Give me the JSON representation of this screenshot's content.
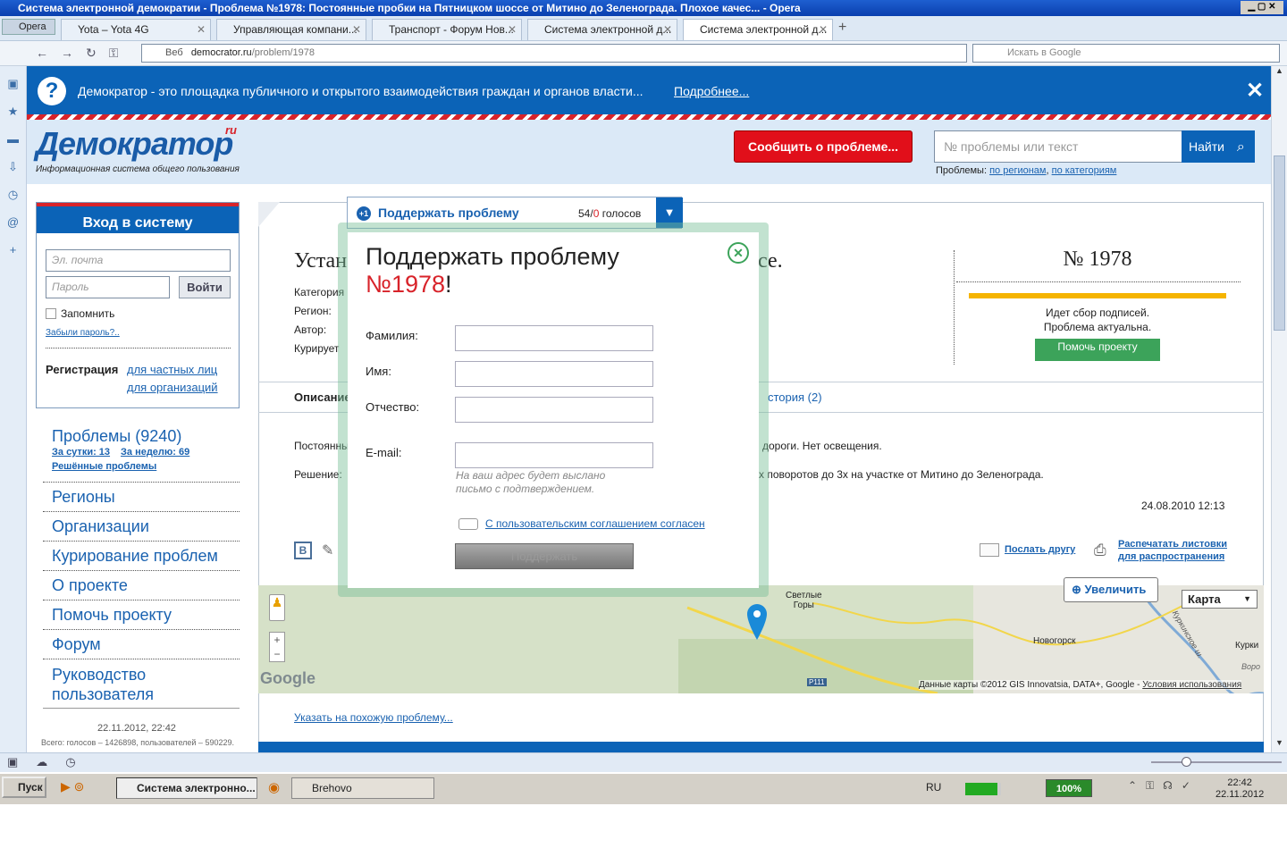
{
  "window": {
    "title": "Система электронной демократии - Проблема №1978: Постоянные пробки на Пятницком шоссе от Митино до Зеленограда. Плохое качес... - Opera",
    "opera_btn": "Opera"
  },
  "tabs": [
    "Yota – Yota 4G",
    "Управляющая компани...",
    "Транспорт - Форум Нов...",
    "Система электронной д...",
    "Система электронной д..."
  ],
  "address": {
    "badge": "Веб",
    "url_host": "democrator.ru",
    "url_path": "/problem/1978",
    "search_placeholder": "Искать в Google"
  },
  "banner": {
    "text": "Демократор - это площадка публичного и открытого взаимодействия граждан и органов власти...",
    "link": "Подробнее..."
  },
  "header": {
    "logo": "Демократор",
    "logo_sup": "ru",
    "tagline": "Информационная система общего пользования",
    "report_btn": "Сообщить о проблеме...",
    "search_placeholder": "№ проблемы или текст",
    "search_btn": "Найти",
    "problems_prefix": "Проблемы:",
    "by_region": "по регионам",
    "by_category": "по категориям"
  },
  "login": {
    "title": "Вход в систему",
    "email_ph": "Эл. почта",
    "pass_ph": "Пароль",
    "login_btn": "Войти",
    "remember": "Запомнить",
    "forgot": "Забыли пароль?..",
    "register": "Регистрация",
    "reg_private": "для частных лиц",
    "reg_org": "для организаций"
  },
  "nav": {
    "problems": "Проблемы (9240)",
    "day": "За сутки: 13",
    "week": "За неделю: 69",
    "solved": "Решённые проблемы",
    "items": [
      "Регионы",
      "Организации",
      "Курирование проблем",
      "О проекте",
      "Помочь проекту",
      "Форум",
      "Руководство пользователя"
    ],
    "date": "22.11.2012, 22:42",
    "stats": "Всего: голосов – 1426898, пользователей – 590229."
  },
  "support_bar": {
    "label": "Поддержать проблему",
    "votes_yes": "54",
    "votes_no": "0",
    "votes_word": "голосов"
  },
  "problem": {
    "title_start": "Устан",
    "title_end": "се.",
    "meta": [
      "Категория",
      "Регион:",
      "Автор:",
      "Курирует"
    ],
    "number": "№ 1978",
    "status1": "Идет сбор подписей.",
    "status2": "Проблема актуальна.",
    "help_btn": "Помочь проекту",
    "tab_desc": "Описание",
    "tab_history": "стория (2)",
    "desc_start": "Постоянны",
    "desc_end": "дороги. Нет освещения.",
    "sol_start": "Решение:",
    "sol_end": "х поворотов до 3х на участке от Митино до Зеленограда.",
    "date": "24.08.2010 12:13",
    "vk": "В",
    "send_friend": "Послать другу",
    "print1": "Распечатать листовки",
    "print2": "для распространения",
    "similar": "Указать на похожую проблему..."
  },
  "map": {
    "zoom": "Увеличить",
    "type": "Карта",
    "place1a": "Светлые",
    "place1b": "Горы",
    "place2": "Новогорск",
    "place3": "Курки",
    "place4": "Воро",
    "road": "Р111",
    "river": "Куркинское ш.",
    "google": "Google",
    "copyright": "Данные карты ©2012 GIS Innovatsia, DATA+, Google -",
    "terms": "Условия использования"
  },
  "modal": {
    "title1": "Поддержать проблему",
    "title_num": "№1978",
    "title_excl": "!",
    "surname": "Фамилия:",
    "name": "Имя:",
    "patronymic": "Отчество:",
    "email": "E-mail:",
    "hint1": "На ваш адрес будет выслано",
    "hint2": "письмо с подтверждением.",
    "agree": "С пользовательским соглашением согласен",
    "submit": "Поддержать"
  },
  "taskbar": {
    "start": "Пуск",
    "task1": "Система электронно...",
    "task2": "Brehovo",
    "lang": "RU",
    "battery": "100%",
    "time": "22:42",
    "date": "22.11.2012"
  }
}
